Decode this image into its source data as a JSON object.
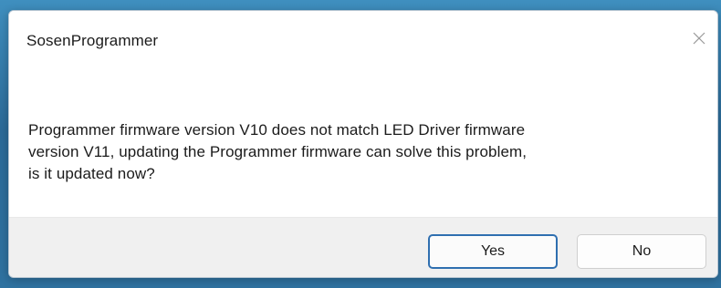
{
  "dialog": {
    "title": "SosenProgrammer",
    "close_icon": "close-icon",
    "message_lines": [
      "Programmer firmware version V10 does not match LED Driver firmware",
      "version V11, updating the Programmer firmware can solve this problem,",
      "is it updated now?"
    ],
    "buttons": {
      "yes_label": "Yes",
      "no_label": "No"
    },
    "colors": {
      "default_button_border": "#2f6fb0",
      "button_bar_background": "#f0f0f0"
    }
  }
}
